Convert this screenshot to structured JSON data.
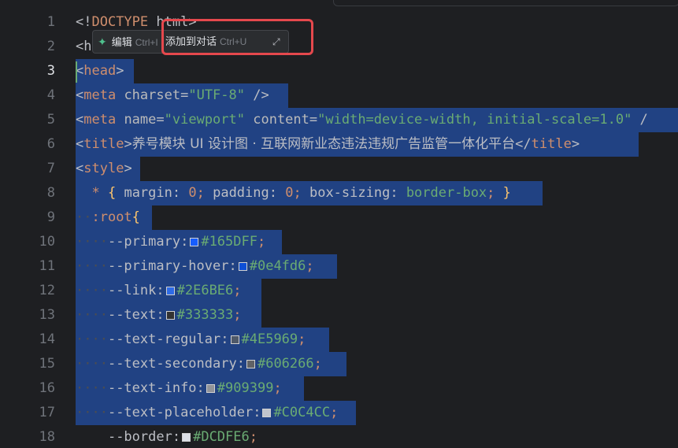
{
  "gutter": [
    "1",
    "2",
    "3",
    "4",
    "5",
    "6",
    "7",
    "8",
    "9",
    "10",
    "11",
    "12",
    "13",
    "14",
    "15",
    "16",
    "17",
    "18"
  ],
  "toolbar": {
    "edit_label": "编辑",
    "edit_shortcut": "Ctrl+I",
    "add_label": "添加到对话",
    "add_shortcut": "Ctrl+U"
  },
  "code": {
    "l1": {
      "a": "<!",
      "b": "DOCTYPE",
      "c": " html",
      "d": ">"
    },
    "l2": {
      "a": "<h"
    },
    "l3": {
      "a": "<",
      "b": "head",
      "c": ">"
    },
    "l4": {
      "a": "<",
      "b": "meta",
      "c": " charset",
      "d": "=",
      "e": "\"UTF-8\"",
      "f": " />"
    },
    "l5": {
      "a": "<",
      "b": "meta",
      "c": " name",
      "d": "=",
      "e": "\"viewport\"",
      "f": " content",
      "g": "=",
      "h": "\"width=device-width, initial-scale=1.0\"",
      "i": " /"
    },
    "l6": {
      "a": "<",
      "b": "title",
      "c": ">",
      "d": "养号模块 UI 设计图 · 互联网新业态违法违规广告监管一体化平台",
      "e": "</",
      "f": "title",
      "g": ">"
    },
    "l7": {
      "a": "<",
      "b": "style",
      "c": ">"
    },
    "l8": {
      "a": "*",
      "b": " {",
      "c": " margin",
      "d": ": ",
      "e": "0",
      "f": "; ",
      "g": "padding",
      "h": ": ",
      "i": "0",
      "j": "; ",
      "k": "box-sizing",
      "l": ": ",
      "m": "border-box",
      "n": "; ",
      "o": "}"
    },
    "l9": {
      "a": ":root",
      "b": "{"
    },
    "vars": [
      {
        "name": "--primary",
        "hex": "#165DFF",
        "color": "#165DFF"
      },
      {
        "name": "--primary-hover",
        "hex": "#0e4fd6",
        "color": "#0e4fd6"
      },
      {
        "name": "--link",
        "hex": "#2E6BE6",
        "color": "#2E6BE6"
      },
      {
        "name": "--text",
        "hex": "#333333",
        "color": "#333333"
      },
      {
        "name": "--text-regular",
        "hex": "#4E5969",
        "color": "#4E5969"
      },
      {
        "name": "--text-secondary",
        "hex": "#606266",
        "color": "#606266"
      },
      {
        "name": "--text-info",
        "hex": "#909399",
        "color": "#909399"
      },
      {
        "name": "--text-placeholder",
        "hex": "#C0C4CC",
        "color": "#C0C4CC"
      },
      {
        "name": "--border",
        "hex": "#DCDFE6",
        "color": "#DCDFE6"
      }
    ]
  }
}
